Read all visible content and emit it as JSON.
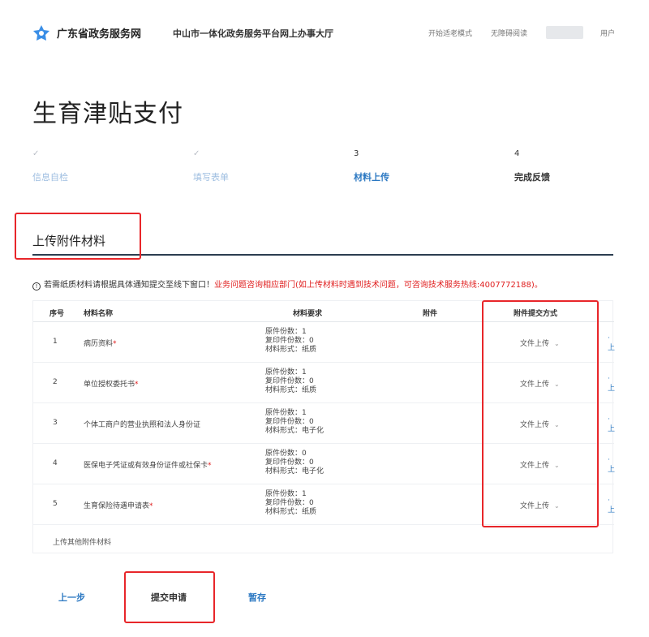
{
  "header": {
    "site_name": "广东省政务服务网",
    "portal_name": "中山市一体化政务服务平台网上办事大厅",
    "elder_mode": "开始适老模式",
    "barrier_free": "无障碍阅读",
    "user": "用户"
  },
  "page_title": "生育津贴支付",
  "steps": [
    {
      "mark": "✓",
      "label": "信息自检",
      "state": "done"
    },
    {
      "mark": "✓",
      "label": "填写表单",
      "state": "done"
    },
    {
      "mark": "3",
      "label": "材料上传",
      "state": "active"
    },
    {
      "mark": "4",
      "label": "完成反馈",
      "state": "todo"
    }
  ],
  "section_title": "上传附件材料",
  "notice": {
    "plain": "若需纸质材料请根据具体通知提交至线下窗口！",
    "red": "业务问题咨询相应部门(如上传材料时遇到技术问题，可咨询技术服务热线:4007772188)。"
  },
  "table": {
    "headers": {
      "no": "序号",
      "name": "材料名称",
      "requirement": "材料要求",
      "attachment": "附件",
      "submit_mode": "附件提交方式"
    },
    "rows": [
      {
        "no": "1",
        "name": "病历资料",
        "required": "*",
        "orig": "原件份数：1",
        "copy": "复印件份数：0",
        "form": "材料形式：纸质",
        "mode": "文件上传"
      },
      {
        "no": "2",
        "name": "单位授权委托书",
        "required": "*",
        "orig": "原件份数：1",
        "copy": "复印件份数：0",
        "form": "材料形式：纸质",
        "mode": "文件上传"
      },
      {
        "no": "3",
        "name": "个体工商户的营业执照和法人身份证",
        "required": "",
        "orig": "原件份数：1",
        "copy": "复印件份数：0",
        "form": "材料形式：电子化",
        "mode": "文件上传"
      },
      {
        "no": "4",
        "name": "医保电子凭证或有效身份证件或社保卡",
        "required": "*",
        "orig": "原件份数：0",
        "copy": "复印件份数：0",
        "form": "材料形式：电子化",
        "mode": "文件上传"
      },
      {
        "no": "5",
        "name": "生育保险待遇申请表",
        "required": "*",
        "orig": "原件份数：1",
        "copy": "复印件份数：0",
        "form": "材料形式：纸质",
        "mode": "文件上传"
      }
    ],
    "upload_other": "上传其他附件材料"
  },
  "buttons": {
    "prev": "上一步",
    "submit": "提交申请",
    "save": "暂存"
  },
  "colors": {
    "accent": "#2b78c2",
    "highlight": "#e8262a",
    "warning_text": "#e02020"
  }
}
